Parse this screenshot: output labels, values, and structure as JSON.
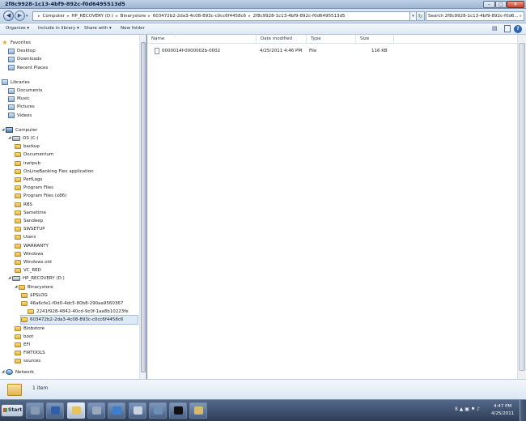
{
  "window": {
    "title": "2f8c9928-1c13-4bf9-892c-f0d6495513d5",
    "controls": {
      "minimize": "–",
      "maximize": "□",
      "close": "✕"
    }
  },
  "address": {
    "crumbs": [
      "Computer",
      "HP_RECOVERY (D:)",
      "Binarystore",
      "603472b2-2da3-4c08-893c-c0cc6f4458c6",
      "2f8c9928-1c13-4bf9-892c-f0d6495513d5"
    ],
    "separator": "▸",
    "search_placeholder": "Search 2f8c9928-1c13-4bf9-892c-f0d6...",
    "back": "◀",
    "forward": "▶",
    "recent": "▾",
    "dropdown": "▾",
    "refresh": "↻",
    "search_icon": "⌕"
  },
  "commands": {
    "organize": "Organize ▾",
    "include": "Include in library ▾",
    "share": "Share with ▾",
    "new_folder": "New folder",
    "view": "▤",
    "help": "?"
  },
  "nav": {
    "groups": [
      {
        "label": "Favorites",
        "icon": "star-icon",
        "items": [
          "Desktop",
          "Downloads",
          "Recent Places"
        ]
      },
      {
        "label": "Libraries",
        "icon": "library-icon",
        "items": [
          "Documents",
          "Music",
          "Pictures",
          "Videos"
        ]
      },
      {
        "label": "Computer",
        "icon": "computer-icon",
        "items": []
      }
    ],
    "drive_c": "OS (C:)",
    "c_folders": [
      "backup",
      "Documentum",
      "inetpub",
      "OnLineBanking Flex application",
      "PerfLogs",
      "Program Files",
      "Program Files (x86)",
      "RBS",
      "Sametime",
      "Sandeep",
      "SWSETUP",
      "Users",
      "WARRANTY",
      "Windows",
      "Windows.old",
      "VC_RED"
    ],
    "drive_d": "HP_RECOVERY (D:)",
    "binarystore": "Binarystore",
    "binary_children": [
      {
        "label": "$PSLOG",
        "depth": 3
      },
      {
        "label": "46a6cfe1-f0d0-4dc5-80b8-290aa9560367",
        "depth": 3
      },
      {
        "label": "2241f928-4842-40cd-9c0f-1aa8b10223fe",
        "depth": 4
      },
      {
        "label": "603472b2-2da3-4c08-893c-c0cc6f4458c6",
        "depth": 3,
        "selected": true
      }
    ],
    "d_folders": [
      "Blobstore",
      "boot",
      "EFI",
      "FIRTOOLS",
      "sources"
    ],
    "network": "Network"
  },
  "columns": {
    "name": "Name",
    "date": "Date modified",
    "type": "Type",
    "size": "Size",
    "sort_arrow": "˄"
  },
  "files": [
    {
      "name": "0000014f-0000002b-0002",
      "date": "4/25/2011 4:46 PM",
      "type": "File",
      "size": "116 KB"
    }
  ],
  "details": {
    "count": "1 item"
  },
  "taskbar": {
    "start": "Start",
    "buttons": [
      {
        "name": "server-manager",
        "color": "#8a9ab0",
        "active": false
      },
      {
        "name": "powershell",
        "color": "#2f5fa8",
        "active": false
      },
      {
        "name": "explorer",
        "color": "#e8c25a",
        "active": true
      },
      {
        "name": "tools",
        "color": "#9aa8bc",
        "active": false
      },
      {
        "name": "internet-explorer",
        "color": "#3b7fd0",
        "active": false
      },
      {
        "name": "documents",
        "color": "#c9d3e0",
        "active": false
      },
      {
        "name": "network-utility",
        "color": "#6e8fb5",
        "active": false
      },
      {
        "name": "command-prompt",
        "color": "#111111",
        "active": false
      },
      {
        "name": "utility",
        "color": "#d8b86a",
        "active": false
      }
    ],
    "tray_icons": "8 ▲ ▣ ⚑ ♪",
    "time": "4:47 PM",
    "date": "4/25/2011"
  }
}
